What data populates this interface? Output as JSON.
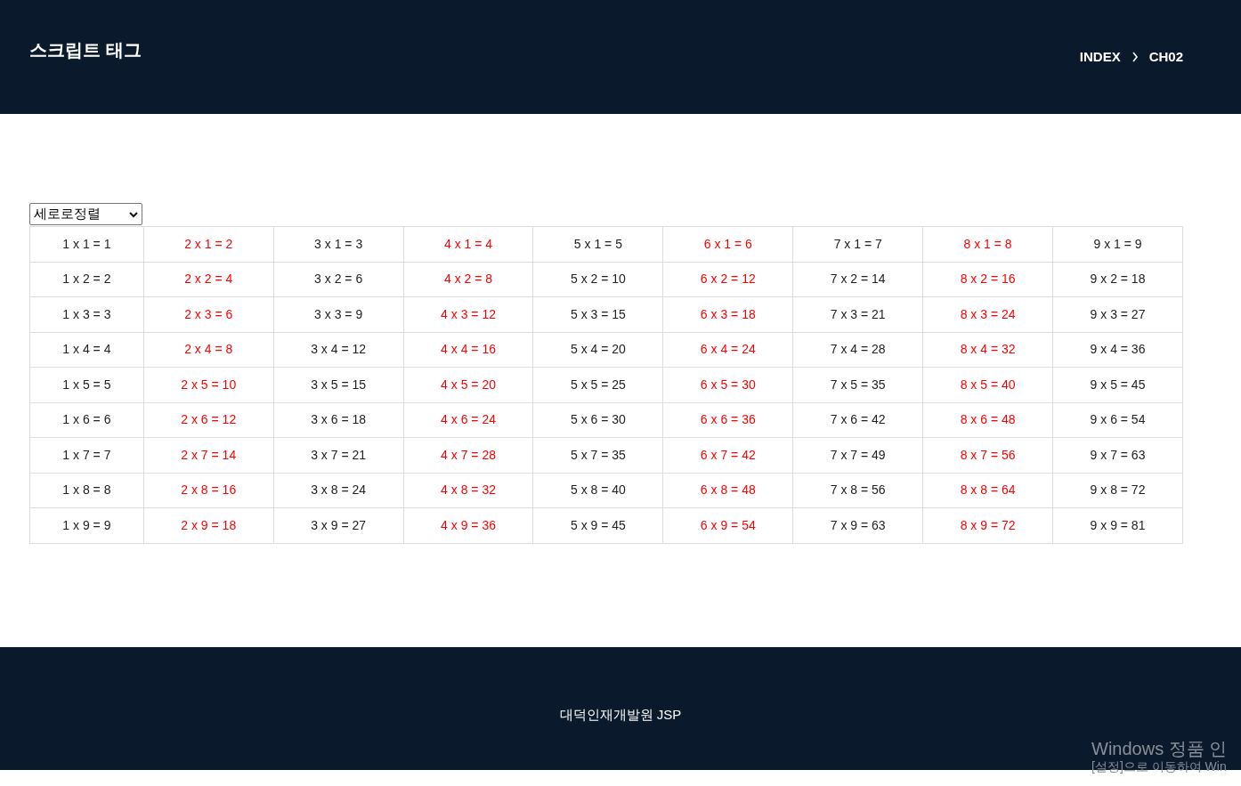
{
  "header": {
    "title": "스크립트 태그",
    "breadcrumb": [
      "INDEX",
      "CH02"
    ]
  },
  "sort_select": {
    "value": "세로로정렬"
  },
  "table": {
    "columns": [
      {
        "highlight": false,
        "cells": [
          "1 x 1 = 1",
          "1 x 2 = 2",
          "1 x 3 = 3",
          "1 x 4 = 4",
          "1 x 5 = 5",
          "1 x 6 = 6",
          "1 x 7 = 7",
          "1 x 8 = 8",
          "1 x 9 = 9"
        ]
      },
      {
        "highlight": true,
        "cells": [
          "2 x 1 = 2",
          "2 x 2 = 4",
          "2 x 3 = 6",
          "2 x 4 = 8",
          "2 x 5 = 10",
          "2 x 6 = 12",
          "2 x 7 = 14",
          "2 x 8 = 16",
          "2 x 9 = 18"
        ]
      },
      {
        "highlight": false,
        "cells": [
          "3 x 1 = 3",
          "3 x 2 = 6",
          "3 x 3 = 9",
          "3 x 4 = 12",
          "3 x 5 = 15",
          "3 x 6 = 18",
          "3 x 7 = 21",
          "3 x 8 = 24",
          "3 x 9 = 27"
        ]
      },
      {
        "highlight": true,
        "cells": [
          "4 x 1 = 4",
          "4 x 2 = 8",
          "4 x 3 = 12",
          "4 x 4 = 16",
          "4 x 5 = 20",
          "4 x 6 = 24",
          "4 x 7 = 28",
          "4 x 8 = 32",
          "4 x 9 = 36"
        ]
      },
      {
        "highlight": false,
        "cells": [
          "5 x 1 = 5",
          "5 x 2 = 10",
          "5 x 3 = 15",
          "5 x 4 = 20",
          "5 x 5 = 25",
          "5 x 6 = 30",
          "5 x 7 = 35",
          "5 x 8 = 40",
          "5 x 9 = 45"
        ]
      },
      {
        "highlight": true,
        "cells": [
          "6 x 1 = 6",
          "6 x 2 = 12",
          "6 x 3 = 18",
          "6 x 4 = 24",
          "6 x 5 = 30",
          "6 x 6 = 36",
          "6 x 7 = 42",
          "6 x 8 = 48",
          "6 x 9 = 54"
        ]
      },
      {
        "highlight": false,
        "cells": [
          "7 x 1 = 7",
          "7 x 2 = 14",
          "7 x 3 = 21",
          "7 x 4 = 28",
          "7 x 5 = 35",
          "7 x 6 = 42",
          "7 x 7 = 49",
          "7 x 8 = 56",
          "7 x 9 = 63"
        ]
      },
      {
        "highlight": true,
        "cells": [
          "8 x 1 = 8",
          "8 x 2 = 16",
          "8 x 3 = 24",
          "8 x 4 = 32",
          "8 x 5 = 40",
          "8 x 6 = 48",
          "8 x 7 = 56",
          "8 x 8 = 64",
          "8 x 9 = 72"
        ]
      },
      {
        "highlight": false,
        "cells": [
          "9 x 1 = 9",
          "9 x 2 = 18",
          "9 x 3 = 27",
          "9 x 4 = 36",
          "9 x 5 = 45",
          "9 x 6 = 54",
          "9 x 7 = 63",
          "9 x 8 = 72",
          "9 x 9 = 81"
        ]
      }
    ]
  },
  "footer": {
    "text": "대덕인재개발원 JSP"
  },
  "os_overlay": {
    "lines": [
      "Windows 정품 인",
      "[설정]으로 이동하여 Win"
    ]
  }
}
